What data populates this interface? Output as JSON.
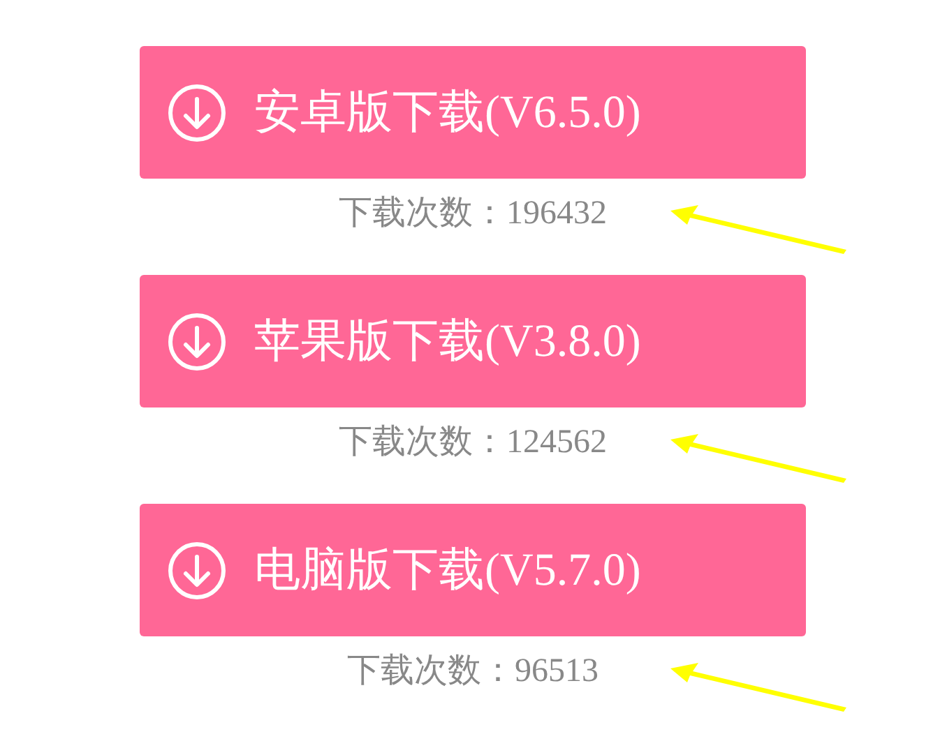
{
  "downloads": [
    {
      "label": "安卓版下载(V6.5.0)",
      "count_label": "下载次数：196432"
    },
    {
      "label": "苹果版下载(V3.8.0)",
      "count_label": "下载次数：124562"
    },
    {
      "label": "电脑版下载(V5.7.0)",
      "count_label": "下载次数：96513"
    }
  ]
}
